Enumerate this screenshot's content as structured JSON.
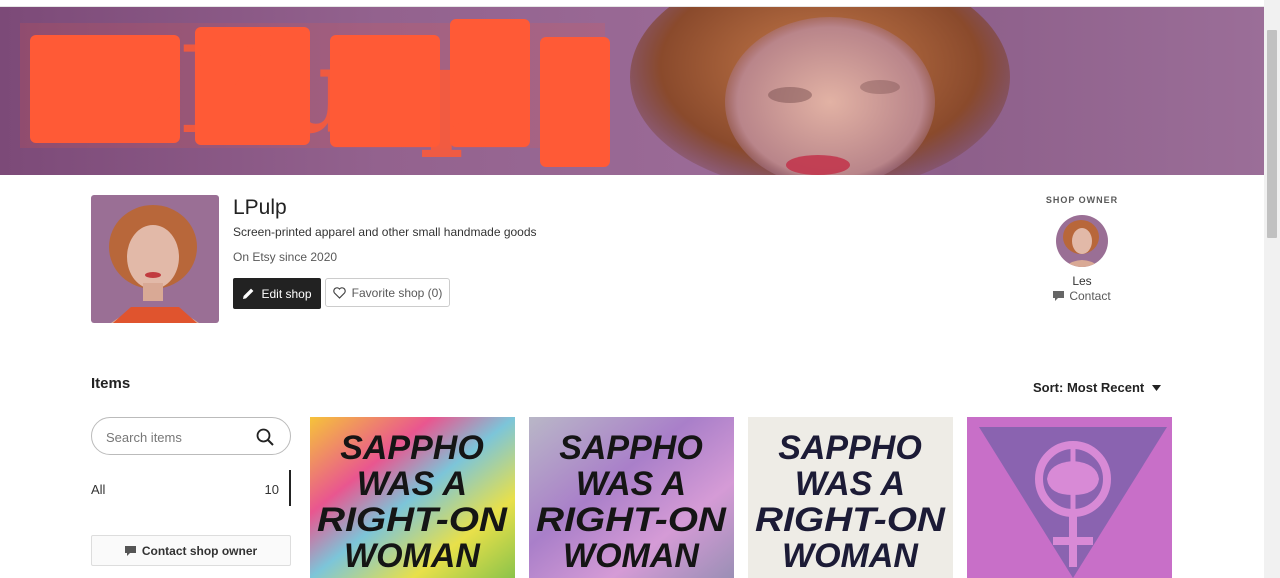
{
  "banner": {
    "logo_text": "L·Pulp"
  },
  "shop": {
    "name": "LPulp",
    "tagline": "Screen-printed apparel and other small handmade goods",
    "since": "On Etsy since 2020",
    "edit_label": "Edit shop",
    "favorite_label": "Favorite shop (0)"
  },
  "owner": {
    "heading": "SHOP OWNER",
    "name": "Les",
    "contact_label": "Contact"
  },
  "items": {
    "title": "Items",
    "sort_label": "Sort: Most Recent",
    "search_placeholder": "Search items",
    "filters": [
      {
        "label": "All",
        "count": "10"
      }
    ],
    "contact_owner_label": "Contact shop owner"
  },
  "listings": [
    {
      "lines": [
        "SAPPHO",
        "WAS A",
        "RIGHT-ON",
        "WOMAN"
      ],
      "background": "tie-dye"
    },
    {
      "lines": [
        "SAPPHO",
        "WAS A",
        "RIGHT-ON",
        "WOMAN"
      ],
      "background": "purple-tie-dye"
    },
    {
      "lines": [
        "SAPPHO",
        "WAS A",
        "RIGHT-ON",
        "WOMAN"
      ],
      "background": "white"
    },
    {
      "lines": [],
      "background": "pink",
      "icon": "labrys-venus-triangle-icon"
    }
  ],
  "colors": {
    "logo_orange": "#ff5a36",
    "banner_purple": "#93628e",
    "dark_button": "#222222"
  }
}
